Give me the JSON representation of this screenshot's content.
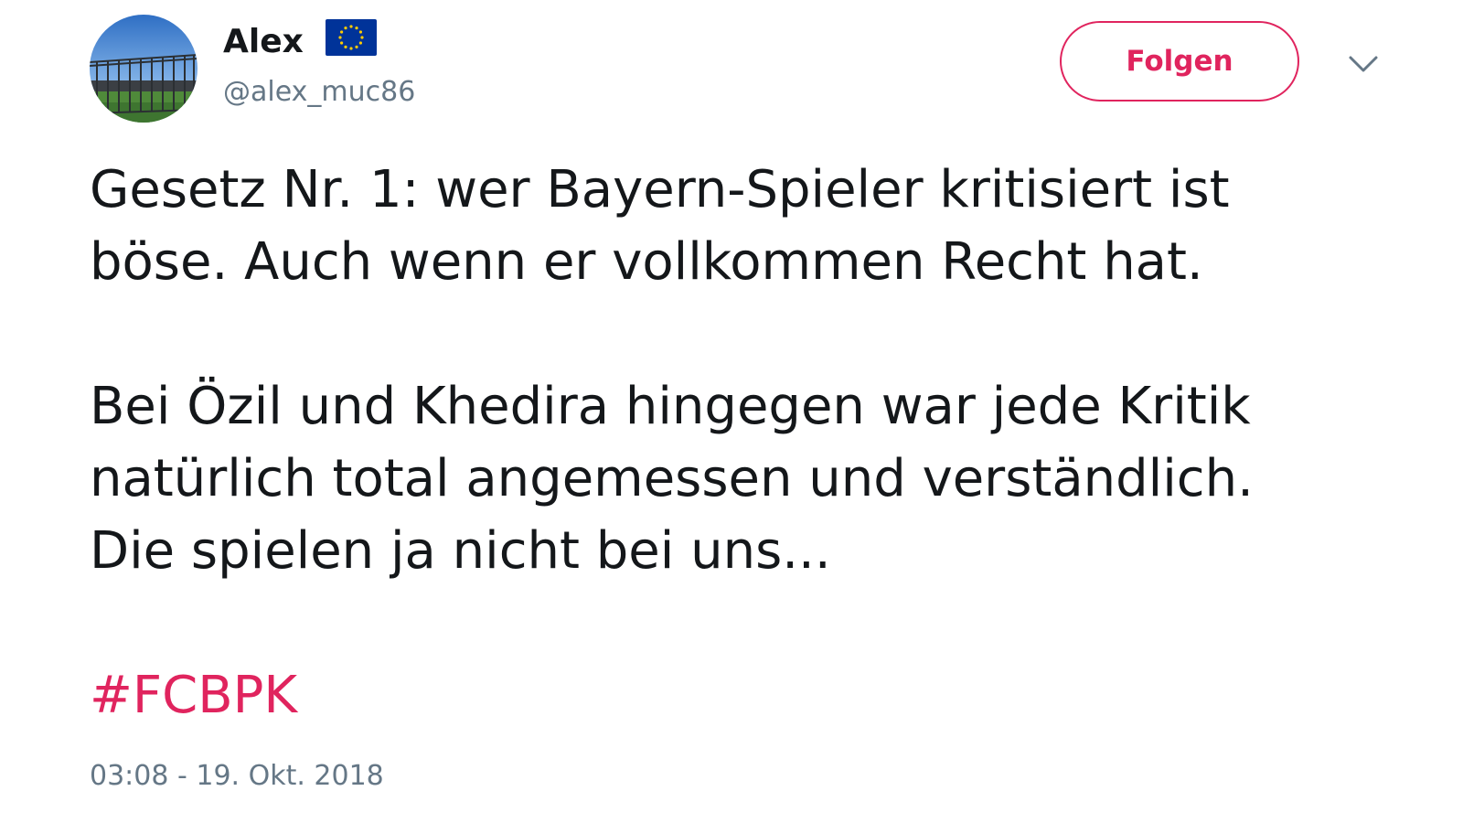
{
  "user": {
    "display_name": "Alex",
    "handle": "@alex_muc86",
    "badge_icon": "eu-flag-icon"
  },
  "actions": {
    "follow_label": "Folgen",
    "menu_icon": "chevron-down-icon"
  },
  "tweet": {
    "line_1": "Gesetz Nr. 1: wer Bayern-Spieler kritisiert ist",
    "line_2": "böse. Auch wenn er vollkommen Recht hat.",
    "line_3": "Bei Özil und Khedira hingegen war jede Kritik",
    "line_4": "natürlich total angemessen und verständlich.",
    "line_5": "Die spielen ja nicht bei uns...",
    "hashtag": "#FCBPK",
    "timestamp": "03:08 - 19. Okt. 2018"
  },
  "colors": {
    "accent": "#e0245e",
    "text": "#14171a",
    "muted": "#657786",
    "eu_blue": "#003399",
    "eu_gold": "#ffcc00"
  }
}
